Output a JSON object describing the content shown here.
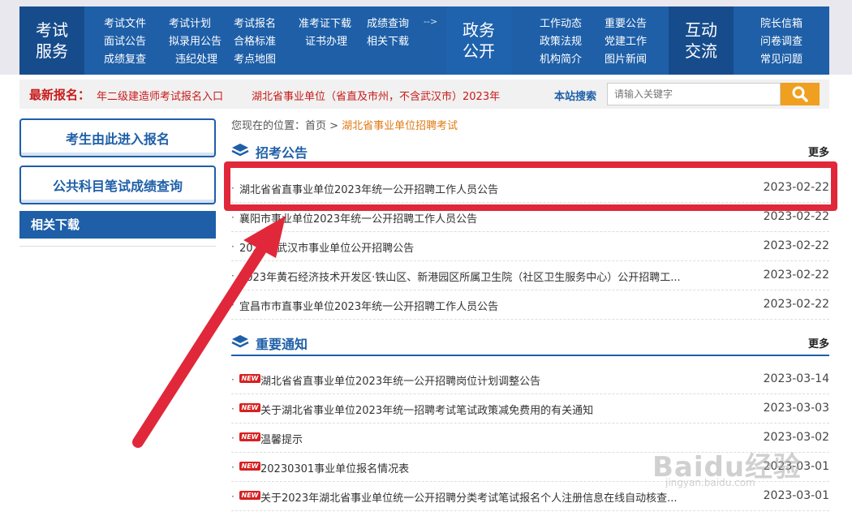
{
  "nav": {
    "exam_service": {
      "title_line1": "考试",
      "title_line2": "服务"
    },
    "exam_links": [
      [
        "考试文件",
        "考试计划",
        "考试报名",
        "准考证下载",
        "成绩查询"
      ],
      [
        "面试公告",
        "拟录用公告",
        "合格标准",
        "证书办理",
        "相关下载"
      ],
      [
        "成绩复查",
        "违纪处理",
        "考点地图"
      ]
    ],
    "gov_affairs": {
      "title_line1": "政务",
      "title_line2": "公开"
    },
    "gov_links": [
      [
        "工作动态",
        "重要公告"
      ],
      [
        "政策法规",
        "党建工作"
      ],
      [
        "机构简介",
        "图片新闻"
      ]
    ],
    "interaction": {
      "title_line1": "互动",
      "title_line2": "交流"
    },
    "interaction_links": [
      "院长信箱",
      "问卷调查",
      "常见问题"
    ],
    "more_arrows": "-->"
  },
  "latest": {
    "title": "最新报名：",
    "items": [
      "年二级建造师考试报名入口",
      "湖北省事业单位（省直及市州，不含武汉市）2023年"
    ]
  },
  "search": {
    "label": "本站搜索",
    "placeholder": "请输入关键字",
    "icon": "search-icon"
  },
  "sidebar": {
    "register_btn": "考生由此进入报名",
    "score_btn": "公共科目笔试成绩查询",
    "downloads_header": "相关下载"
  },
  "breadcrumb": {
    "prefix": "您现在的位置：首页 > ",
    "current": "湖北省事业单位招聘考试"
  },
  "announcements": {
    "title": "招考公告",
    "more": "更多",
    "items": [
      {
        "title": "湖北省省直事业单位2023年统一公开招聘工作人员公告",
        "date": "2023-02-22"
      },
      {
        "title": "襄阳市事业单位2023年统一公开招聘工作人员公告",
        "date": "2023-02-22"
      },
      {
        "title": "2023年武汉市事业单位公开招聘公告",
        "date": "2023-02-22"
      },
      {
        "title": "2023年黄石经济技术开发区·铁山区、新港园区所属卫生院（社区卫生服务中心）公开招聘工...",
        "date": "2023-02-22"
      },
      {
        "title": "宜昌市市直事业单位2023年统一公开招聘工作人员公告",
        "date": "2023-02-22"
      }
    ]
  },
  "notices": {
    "title": "重要通知",
    "more": "更多",
    "new_badge": "NEW",
    "items": [
      {
        "title": "湖北省省直事业单位2023年统一公开招聘岗位计划调整公告",
        "date": "2023-03-14"
      },
      {
        "title": "关于湖北省事业单位2023年统一招聘考试笔试政策减免费用的有关通知",
        "date": "2023-03-03"
      },
      {
        "title": "温馨提示",
        "date": "2023-03-02"
      },
      {
        "title": "20230301事业单位报名情况表",
        "date": "2023-03-01"
      },
      {
        "title": "关于2023年湖北省事业单位统一公开招聘分类考试笔试报名个人注册信息在线自动核查...",
        "date": "2023-03-01"
      }
    ]
  },
  "watermark": {
    "text": "Baidu经验",
    "sub": "jingyan.baidu.com"
  },
  "colors": {
    "primary": "#1e5fa8",
    "accent_red": "#c81b1b",
    "annotation": "#e0283a",
    "search_btn": "#f0a020"
  }
}
